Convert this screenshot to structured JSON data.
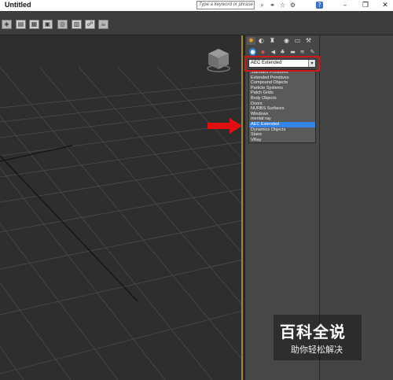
{
  "window": {
    "title": "Untitled",
    "search_placeholder": "Type a keyword or phrase",
    "minimize": "–",
    "restore": "❐",
    "close": "✕"
  },
  "title_icons": [
    "search-icon",
    "binoculars-icon",
    "star-icon",
    "help-icon"
  ],
  "toolbar_icons": [
    "open-icon",
    "render-setup-icon",
    "render-frame-icon",
    "render-icon",
    "material-editor-icon",
    "link-icon",
    "unlink-icon",
    "bind-icon"
  ],
  "command_panel": {
    "tabs": [
      "create-tab",
      "modify-tab",
      "hierarchy-tab",
      "motion-tab",
      "display-tab",
      "utilities-tab"
    ],
    "subtabs": [
      "geometry-icon",
      "shapes-icon",
      "lights-icon",
      "cameras-icon",
      "helpers-icon",
      "space-warps-icon",
      "systems-icon"
    ],
    "dropdown_value": "AEC Extended",
    "list_items": [
      "Standard Primitives",
      "Extended Primitives",
      "Compound Objects",
      "Particle Systems",
      "Patch Grids",
      "Body Objects",
      "Doors",
      "NURBS Surfaces",
      "Windows",
      "mental ray",
      "AEC Extended",
      "Dynamics Objects",
      "Stairs",
      "VRay"
    ],
    "selected_item": "AEC Extended"
  },
  "colors": {
    "highlight_border": "#d01818",
    "annotation_arrow": "#e01010",
    "selection": "#3384e6",
    "viewport_border": "#a08a2a"
  },
  "watermark": {
    "line1": "百科全说",
    "line2": "助你轻松解决"
  }
}
